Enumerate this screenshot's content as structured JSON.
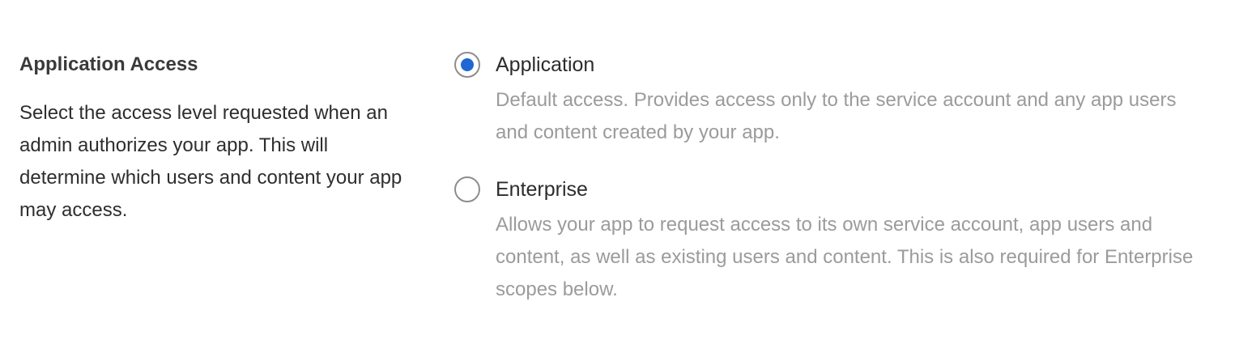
{
  "accent_color": "#2166d5",
  "section": {
    "title": "Application Access",
    "description": "Select the access level requested when an admin authorizes your app. This will determine which users and content your app may access."
  },
  "options": [
    {
      "label": "Application",
      "description": "Default access. Provides access only to the service account and any app users and content created by your app.",
      "selected": true
    },
    {
      "label": "Enterprise",
      "description": "Allows your app to request access to its own service account, app users and content, as well as existing users and content. This is also required for Enterprise scopes below.",
      "selected": false
    }
  ]
}
